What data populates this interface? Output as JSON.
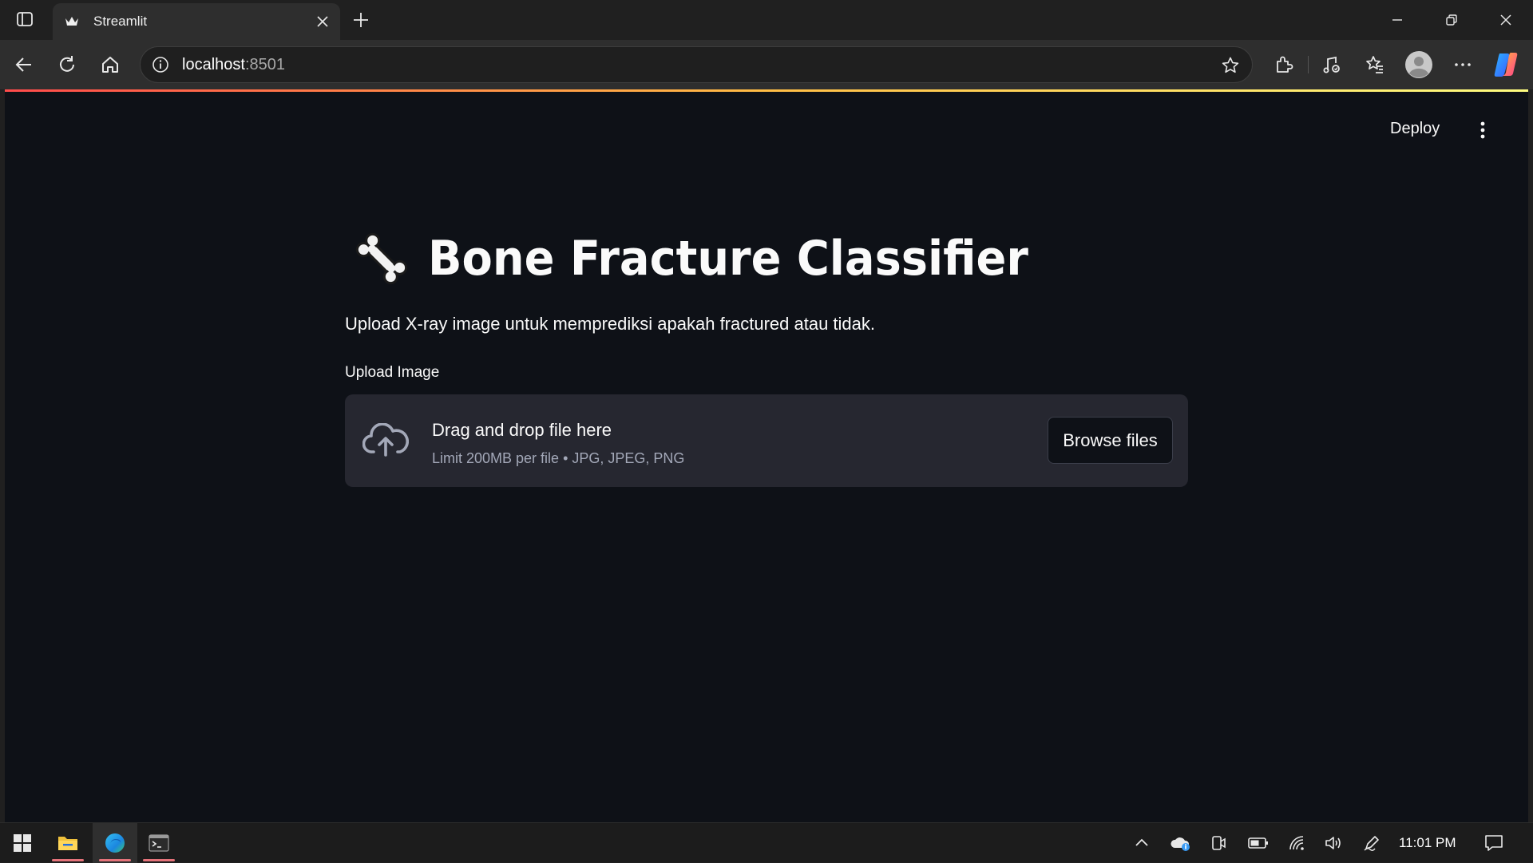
{
  "browser": {
    "tab_title": "Streamlit",
    "url_host": "localhost",
    "url_port": ":8501"
  },
  "app": {
    "deploy_label": "Deploy",
    "title": "Bone Fracture Classifier",
    "subtitle": "Upload X-ray image untuk memprediksi apakah fractured atau tidak.",
    "uploader": {
      "label": "Upload Image",
      "drop_text": "Drag and drop file here",
      "limit_text": "Limit 200MB per file • JPG, JPEG, PNG",
      "browse_label": "Browse files"
    }
  },
  "taskbar": {
    "clock": "11:01 PM"
  },
  "colors": {
    "app_background": "#0e1117",
    "dropzone_background": "#262730",
    "accent_gradient": [
      "#ff4b4b",
      "#ffbd45",
      "#fffd80"
    ]
  }
}
